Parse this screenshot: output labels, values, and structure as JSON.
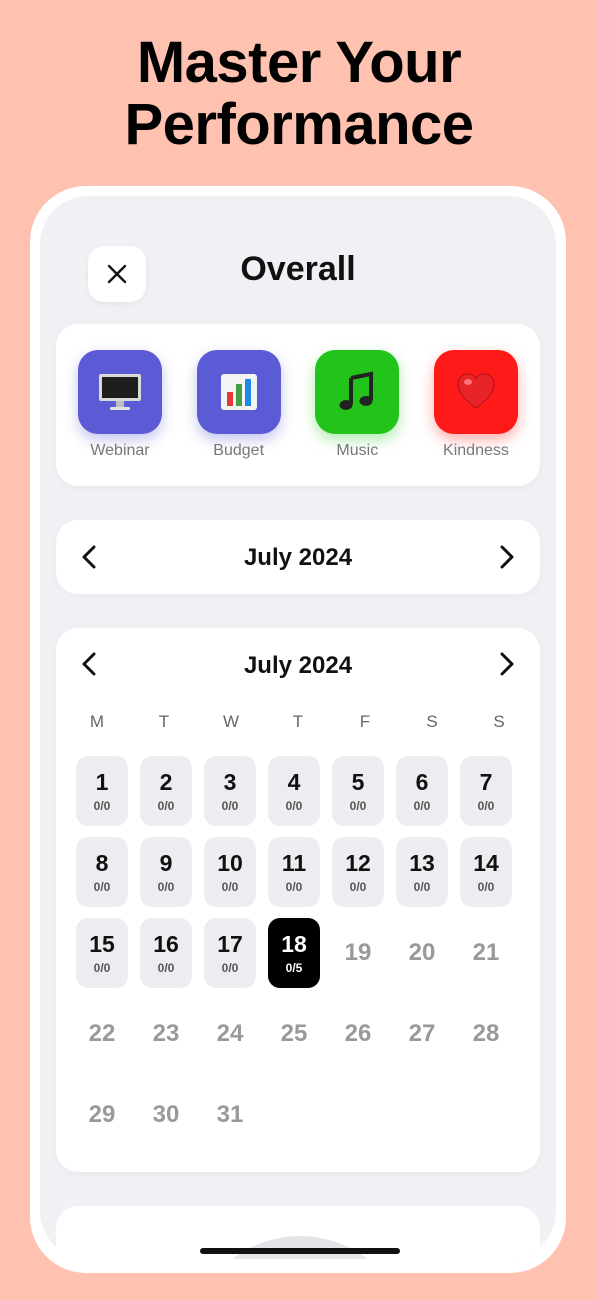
{
  "headline": {
    "line1": "Master Your",
    "line2": "Performance"
  },
  "header": {
    "title": "Overall"
  },
  "categories": [
    {
      "label": "Webinar",
      "icon": "monitor-icon",
      "color": "#5B5BD6"
    },
    {
      "label": "Budget",
      "icon": "bar-chart-icon",
      "color": "#5B5BD6"
    },
    {
      "label": "Music",
      "icon": "music-note-icon",
      "color": "#22C41C"
    },
    {
      "label": "Kindness",
      "icon": "heart-icon",
      "color": "#FF1A1A"
    }
  ],
  "month_selector": {
    "label": "July 2024"
  },
  "calendar": {
    "month_label": "July 2024",
    "weekdays": [
      "M",
      "T",
      "W",
      "T",
      "F",
      "S",
      "S"
    ],
    "weeks": [
      [
        {
          "day": "1",
          "score": "0/0",
          "state": "filled"
        },
        {
          "day": "2",
          "score": "0/0",
          "state": "filled"
        },
        {
          "day": "3",
          "score": "0/0",
          "state": "filled"
        },
        {
          "day": "4",
          "score": "0/0",
          "state": "filled"
        },
        {
          "day": "5",
          "score": "0/0",
          "state": "filled"
        },
        {
          "day": "6",
          "score": "0/0",
          "state": "filled"
        },
        {
          "day": "7",
          "score": "0/0",
          "state": "filled"
        }
      ],
      [
        {
          "day": "8",
          "score": "0/0",
          "state": "filled"
        },
        {
          "day": "9",
          "score": "0/0",
          "state": "filled"
        },
        {
          "day": "10",
          "score": "0/0",
          "state": "filled"
        },
        {
          "day": "11",
          "score": "0/0",
          "state": "filled"
        },
        {
          "day": "12",
          "score": "0/0",
          "state": "filled"
        },
        {
          "day": "13",
          "score": "0/0",
          "state": "filled"
        },
        {
          "day": "14",
          "score": "0/0",
          "state": "filled"
        }
      ],
      [
        {
          "day": "15",
          "score": "0/0",
          "state": "filled"
        },
        {
          "day": "16",
          "score": "0/0",
          "state": "filled"
        },
        {
          "day": "17",
          "score": "0/0",
          "state": "filled"
        },
        {
          "day": "18",
          "score": "0/5",
          "state": "today"
        },
        {
          "day": "19",
          "score": "",
          "state": "future"
        },
        {
          "day": "20",
          "score": "",
          "state": "future"
        },
        {
          "day": "21",
          "score": "",
          "state": "future"
        }
      ],
      [
        {
          "day": "22",
          "score": "",
          "state": "future"
        },
        {
          "day": "23",
          "score": "",
          "state": "future"
        },
        {
          "day": "24",
          "score": "",
          "state": "future"
        },
        {
          "day": "25",
          "score": "",
          "state": "future"
        },
        {
          "day": "26",
          "score": "",
          "state": "future"
        },
        {
          "day": "27",
          "score": "",
          "state": "future"
        },
        {
          "day": "28",
          "score": "",
          "state": "future"
        }
      ],
      [
        {
          "day": "29",
          "score": "",
          "state": "future"
        },
        {
          "day": "30",
          "score": "",
          "state": "future"
        },
        {
          "day": "31",
          "score": "",
          "state": "future"
        },
        {
          "day": "",
          "score": "",
          "state": "empty"
        },
        {
          "day": "",
          "score": "",
          "state": "empty"
        },
        {
          "day": "",
          "score": "",
          "state": "empty"
        },
        {
          "day": "",
          "score": "",
          "state": "empty"
        }
      ]
    ]
  }
}
